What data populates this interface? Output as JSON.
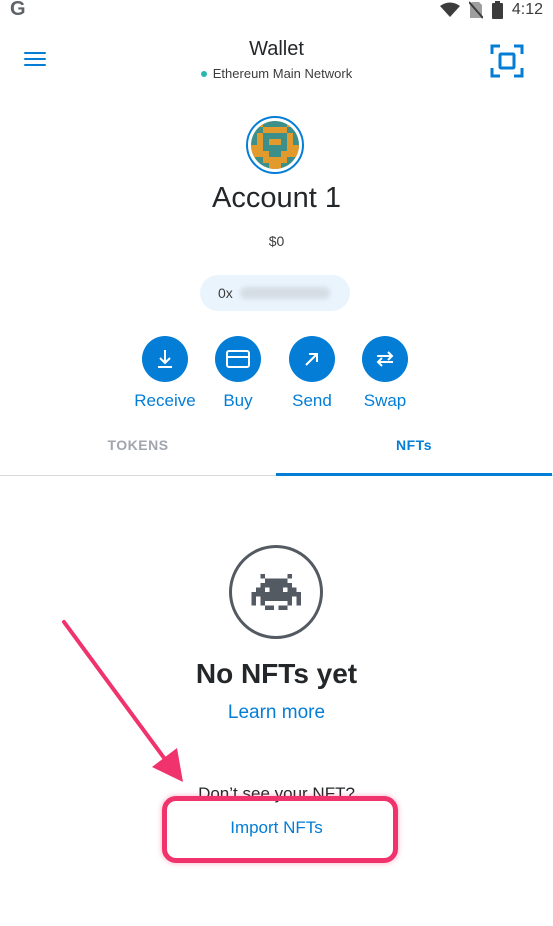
{
  "status_bar": {
    "time": "4:12",
    "logo": "G"
  },
  "header": {
    "title": "Wallet",
    "network": "Ethereum Main Network",
    "network_dot_color": "#29b6af",
    "menu_icon": "hamburger-menu-icon",
    "scan_icon": "qr-scan-icon"
  },
  "account": {
    "name": "Account 1",
    "balance": "$0",
    "address_prefix": "0x"
  },
  "actions": [
    {
      "label": "Receive",
      "icon": "download-arrow-icon"
    },
    {
      "label": "Buy",
      "icon": "credit-card-icon"
    },
    {
      "label": "Send",
      "icon": "arrow-up-right-icon"
    },
    {
      "label": "Swap",
      "icon": "swap-arrows-icon"
    }
  ],
  "tabs": [
    {
      "label": "TOKENS",
      "active": false
    },
    {
      "label": "NFTs",
      "active": true
    }
  ],
  "nft_empty": {
    "heading": "No NFTs yet",
    "learn_more": "Learn more",
    "dont_see": "Don’t see your NFT?",
    "import": "Import NFTs"
  },
  "colors": {
    "accent": "#037dd6",
    "annotation": "#f0336c",
    "text": "#24272a"
  }
}
